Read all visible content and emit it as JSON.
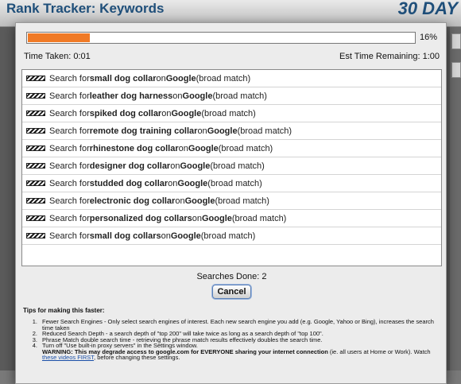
{
  "background": {
    "title": "Rank Tracker: Keywords",
    "badge": "30 DAY"
  },
  "progress": {
    "percent_label": "16%",
    "fraction": 0.16,
    "color": "#f07a26"
  },
  "time": {
    "taken": "Time Taken: 0:01",
    "remaining": "Est Time Remaining: 1:00"
  },
  "searches": [
    {
      "prefix": "Search for",
      "keyword": "small dog collar",
      "on": "on",
      "engine": "Google",
      "match": "(broad match)"
    },
    {
      "prefix": "Search for",
      "keyword": "leather dog harness",
      "on": "on",
      "engine": "Google",
      "match": "(broad match)"
    },
    {
      "prefix": "Search for",
      "keyword": "spiked dog collar",
      "on": "on",
      "engine": "Google",
      "match": "(broad match)"
    },
    {
      "prefix": "Search for",
      "keyword": "remote dog training collar",
      "on": "on",
      "engine": "Google",
      "match": "(broad match)"
    },
    {
      "prefix": "Search for",
      "keyword": "rhinestone dog collar",
      "on": "on",
      "engine": "Google",
      "match": "(broad match)"
    },
    {
      "prefix": "Search for",
      "keyword": "designer dog collar",
      "on": "on",
      "engine": "Google",
      "match": "(broad match)"
    },
    {
      "prefix": "Search for",
      "keyword": "studded dog collar",
      "on": "on",
      "engine": "Google",
      "match": "(broad match)"
    },
    {
      "prefix": "Search for",
      "keyword": "electronic dog collar",
      "on": "on",
      "engine": "Google",
      "match": "(broad match)"
    },
    {
      "prefix": "Search for",
      "keyword": "personalized dog collars",
      "on": "on",
      "engine": "Google",
      "match": "(broad match)"
    },
    {
      "prefix": "Search for",
      "keyword": "small dog collars",
      "on": "on",
      "engine": "Google",
      "match": "(broad match)"
    }
  ],
  "searches_done": "Searches Done: 2",
  "cancel_label": "Cancel",
  "tips": {
    "heading": "Tips for making this faster:",
    "items": [
      {
        "num": "1.",
        "text": "Fewer Search Engines - Only select search engines of interest. Each new search engine you add (e.g. Google, Yahoo or Bing), increases the search time taken"
      },
      {
        "num": "2.",
        "text": "Reduced Search Depth - a search depth of \"top 200\" will take twice as long as a search depth of \"top 100\"."
      },
      {
        "num": "3.",
        "text": "Phrase Match double search time - retrieving the phrase match results effectively doubles the search time."
      },
      {
        "num": "4.",
        "text": "Turn off \"Use built-in proxy servers\" in the Settings window."
      }
    ],
    "warning_bold": "WARNING: This may degrade access to google.com for EVERYONE sharing your internet connection",
    "warning_rest": " (ie. all users at Home or Work). Watch ",
    "warning_link": "these videos FIRST",
    "warning_end": ", before changing these settings."
  }
}
